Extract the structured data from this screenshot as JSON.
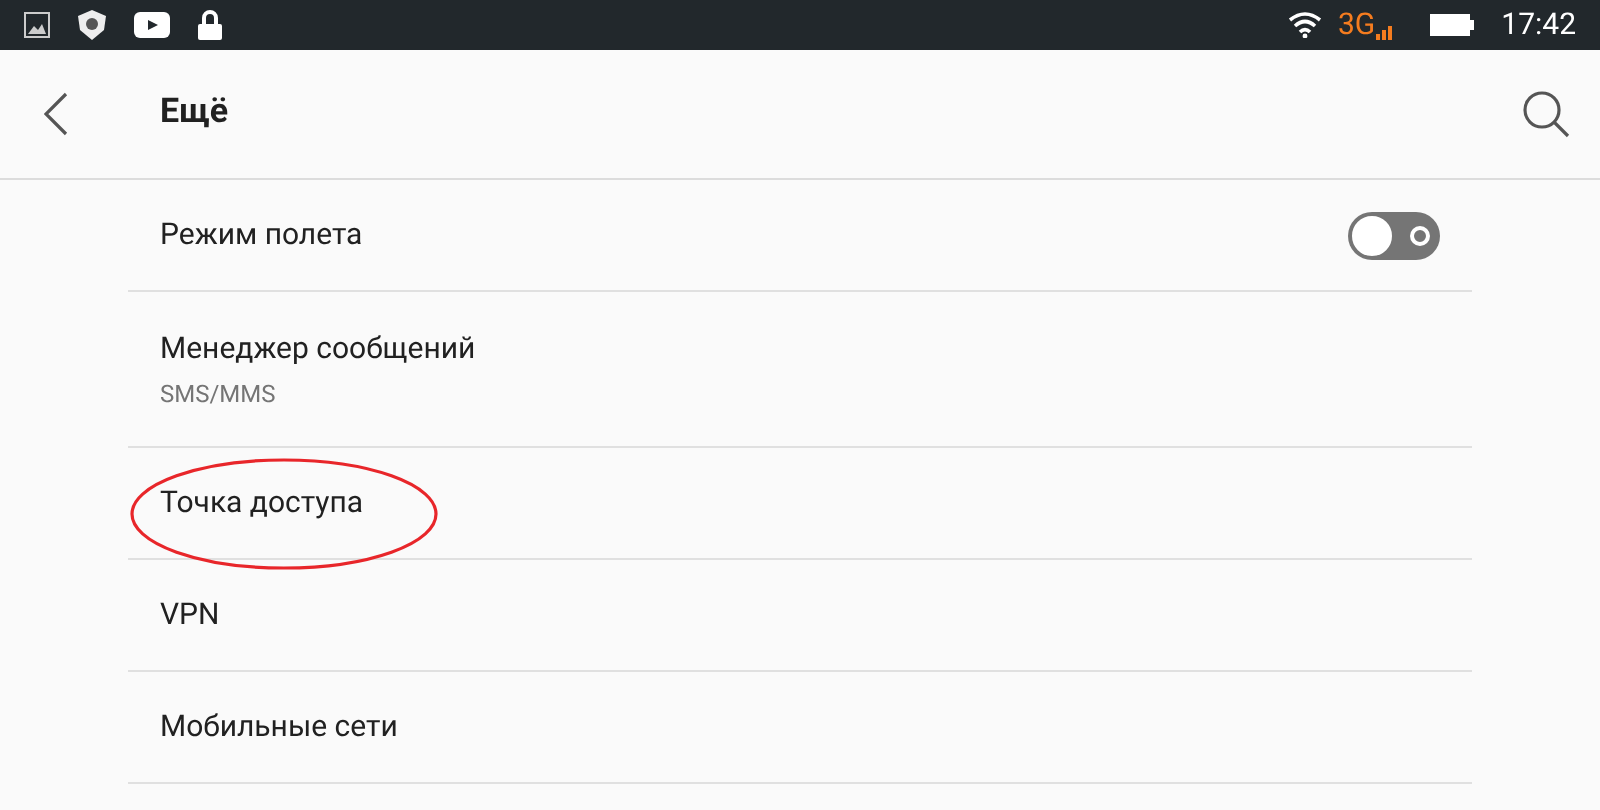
{
  "status_bar": {
    "network": "3G",
    "time": "17:42"
  },
  "header": {
    "title": "Ещё"
  },
  "items": [
    {
      "kind": "toggle",
      "title": "Режим полета",
      "on": false,
      "circled": false
    },
    {
      "kind": "text",
      "title": "Менеджер сообщений",
      "subtitle": "SMS/MMS",
      "circled": false
    },
    {
      "kind": "text",
      "title": "Точка доступа",
      "circled": true
    },
    {
      "kind": "text",
      "title": "VPN",
      "circled": false
    },
    {
      "kind": "text",
      "title": "Мобильные сети",
      "circled": false
    }
  ]
}
